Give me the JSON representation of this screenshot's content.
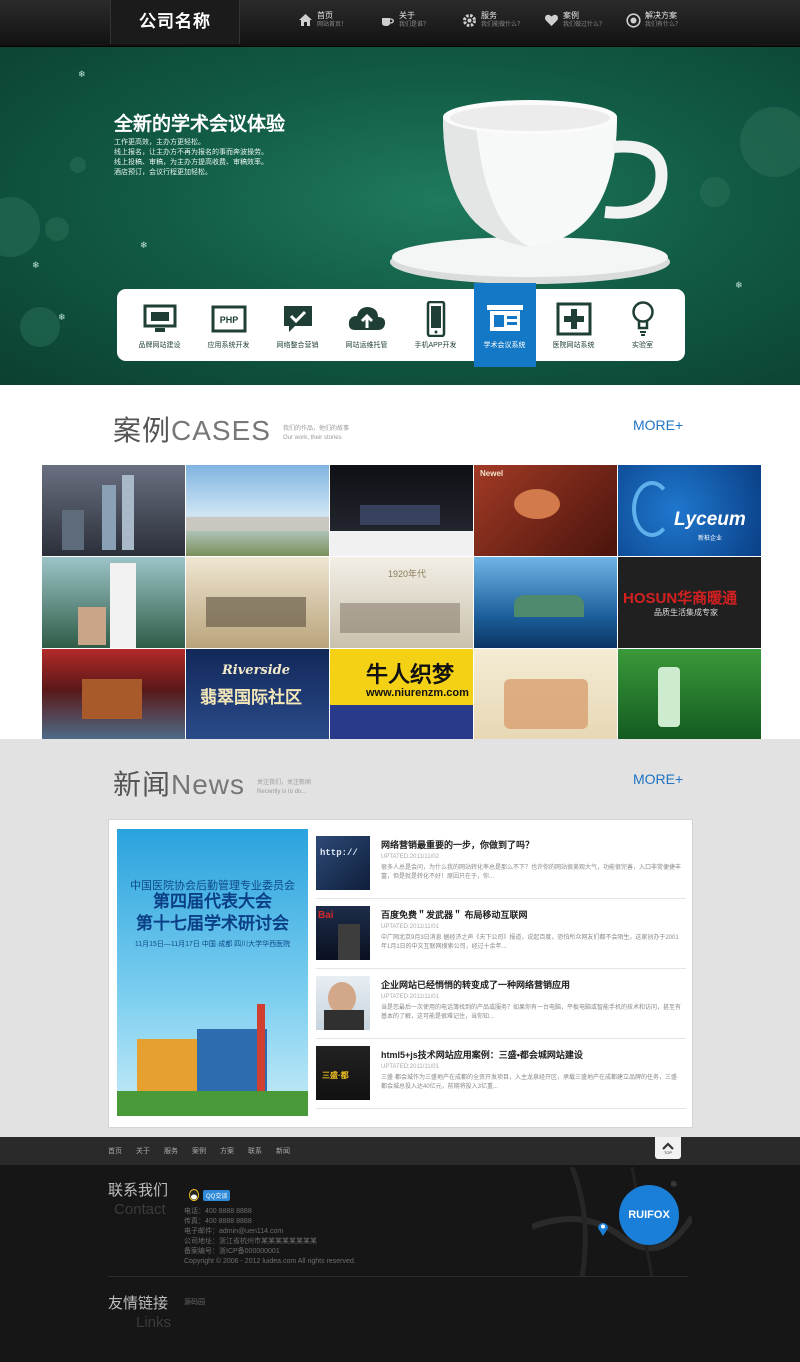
{
  "header": {
    "logo": "公司名称",
    "nav": [
      {
        "icon": "home-icon",
        "title": "首页",
        "sub": "网站首页！"
      },
      {
        "icon": "coffee-cup-icon",
        "title": "关于",
        "sub": "我们是谁？"
      },
      {
        "icon": "gear-icon",
        "title": "服务",
        "sub": "我们能做什么？"
      },
      {
        "icon": "heart-icon",
        "title": "案例",
        "sub": "我们做过什么？"
      },
      {
        "icon": "target-icon",
        "title": "解决方案",
        "sub": "我们有什么？"
      }
    ]
  },
  "hero": {
    "title": "全新的学术会议体验",
    "lines": [
      "工作更高效，主办方更轻松。",
      "线上报名，让主办方不再为报名的事而奔波操劳。",
      "线上投稿、审稿，为主办方提高收费、审稿效率。",
      "酒店预订，会议行程更加轻松。"
    ],
    "services": [
      {
        "icon": "monitor-icon",
        "label": "品牌网站建设"
      },
      {
        "icon": "php-icon",
        "label": "应用系统开发"
      },
      {
        "icon": "chat-check-icon",
        "label": "网络整合营销"
      },
      {
        "icon": "cloud-upload-icon",
        "label": "网站运维托管"
      },
      {
        "icon": "mobile-icon",
        "label": "手机APP开发"
      },
      {
        "icon": "presentation-icon",
        "label": "学术会议系统"
      },
      {
        "icon": "medical-cross-icon",
        "label": "医院网站系统"
      },
      {
        "icon": "lightbulb-icon",
        "label": "实验室"
      }
    ]
  },
  "cases": {
    "title_cn": "案例",
    "title_en": "CASES",
    "sub1": "我们的作品，他们的故事",
    "sub2": "Our work, their stories",
    "more": "MORE+",
    "tiles": [
      {
        "bg": "#4a5260",
        "text": ""
      },
      {
        "bg": "#6a9bc8",
        "text": ""
      },
      {
        "bg": "#1a1c22",
        "text": ""
      },
      {
        "bg": "#7a2a1e",
        "text": "Newel"
      },
      {
        "bg": "#0d4fa0",
        "text": "Lyceum"
      },
      {
        "bg": "#3d6a4e",
        "text": ""
      },
      {
        "bg": "#d6c7a8",
        "text": ""
      },
      {
        "bg": "#e9e5dc",
        "text": "1920年代"
      },
      {
        "bg": "#1d6ca8",
        "text": ""
      },
      {
        "bg": "#1f1f1f",
        "text": "HOSUN华商暖通"
      },
      {
        "bg": "#8a1e1e",
        "text": ""
      },
      {
        "bg": "#1b3d7a",
        "text": "翡翠国际社区"
      },
      {
        "bg": "#f2c21a",
        "text": "牛人织梦"
      },
      {
        "bg": "#f3ead2",
        "text": ""
      },
      {
        "bg": "#2f8a2a",
        "text": ""
      }
    ],
    "tile_sub": {
      "lyceum_small": "新桩企业",
      "hosun_sub": "品质生活集成专家",
      "riverside": "Riverside",
      "niuren_url": "www.niurenzm.com"
    }
  },
  "news": {
    "title_cn": "新闻",
    "title_en": "News",
    "sub1": "关注我们，关注新闻",
    "sub2": "Recently is to do...",
    "more": "MORE+",
    "poster": {
      "line1": "中国医院协会后勤管理专业委员会",
      "line2": "第四届代表大会",
      "line3": "第十七届学术研讨会",
      "line4": "11月15日—11月17日 中国·成都  四川大学华西医院"
    },
    "items": [
      {
        "title": "网络营销最重要的一步，你做到了吗？",
        "date": "UPTATED:2011/11/02",
        "text": "很多人总是会问，为什么我的网站转化率总是那么不下？也许你的网站很美观大气，功能很完善，入口非常便捷丰富，但是就是转化不好！原因只在于，你..."
      },
      {
        "title": "百度免费＂发武器＂ 布局移动互联网",
        "date": "UPTATED:2011/11/01",
        "text": "中广网北京9月3日消息 据经济之声《天下公司》报道，说起百度，恐怕所众网友们都不会陌生。这家创办于2001年1月1日的中文互联网搜索公司，经过十余年..."
      },
      {
        "title": "企业网站已经悄悄的转变成了一种网络营销应用",
        "date": "UPTATED:2011/11/01",
        "text": "当是您最后一次使用的电话簿找到的产品或服务？如果你有一台电脑，平板电脑或智能手机的技术和访问，甚至有基本的了解，这可能是很难记住，当你知..."
      },
      {
        "title": "html5+js技术网站应用案例：三盛•都会城网站建设",
        "date": "UPTATED:2011/11/01",
        "text": "三盛·都会城作为三盛地产在成都的全资开发项目，入主龙泉经开区，承载三盛地产在成都建立品牌的任务，三盛·都会城总投入达40亿元，前期将投入3亿重..."
      }
    ]
  },
  "footer": {
    "nav": [
      "首页",
      "关于",
      "服务",
      "案例",
      "方案",
      "联系",
      "新闻"
    ],
    "top_label": "TOP",
    "contact_cn": "联系我们",
    "contact_en": "Contact",
    "qq_label": "QQ交谈",
    "info": [
      "电话：400 8888 8888",
      "传真：400 8888 8888",
      "电子邮件：admin@uen114.com",
      "公司地址：浙江省杭州市某某某某某某某某",
      "备案编号：浙ICP备000000001",
      "Copyright © 2006 - 2012 luidea.com All rights reserved."
    ],
    "links_cn": "友情链接",
    "links_en": "Links",
    "links_item": "源码园",
    "map_logo": "RUIFOX",
    "accent": "#1a7fd8"
  }
}
